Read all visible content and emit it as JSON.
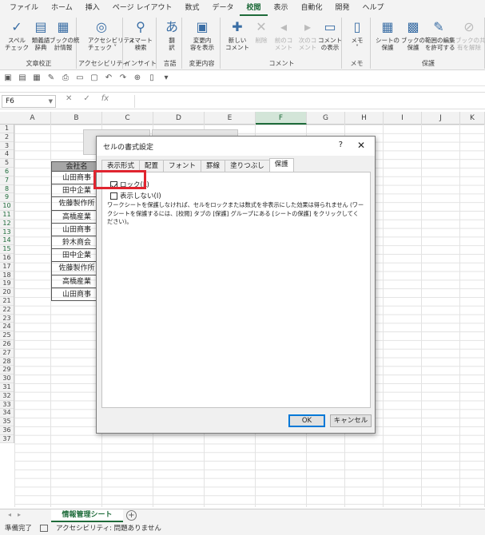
{
  "ribbon_tabs": [
    "ファイル",
    "ホーム",
    "挿入",
    "ページ レイアウト",
    "数式",
    "データ",
    "校閲",
    "表示",
    "自動化",
    "開発",
    "ヘルプ"
  ],
  "active_tab_index": 6,
  "ribbon": {
    "groups": [
      {
        "name": "文章校正",
        "buttons": [
          {
            "label": "スペル\nチェック",
            "icon": "spellcheck-icon"
          },
          {
            "label": "類義語\n辞典",
            "icon": "thesaurus-icon"
          },
          {
            "label": "ブックの統\n計情報",
            "icon": "workbook-stats-icon"
          }
        ]
      },
      {
        "name": "アクセシビリティ",
        "buttons": [
          {
            "label": "アクセシビリティ\nチェック ˅",
            "icon": "accessibility-icon"
          }
        ]
      },
      {
        "name": "インサイト",
        "buttons": [
          {
            "label": "スマート\n検索",
            "icon": "smart-lookup-icon"
          }
        ]
      },
      {
        "name": "言語",
        "buttons": [
          {
            "label": "翻\n訳",
            "icon": "translate-icon"
          }
        ]
      },
      {
        "name": "変更内容",
        "buttons": [
          {
            "label": "変更内\n容を表示",
            "icon": "show-changes-icon"
          }
        ]
      },
      {
        "name": "コメント",
        "buttons": [
          {
            "label": "新しい\nコメント",
            "icon": "new-comment-icon"
          },
          {
            "label": "削除",
            "icon": "delete-comment-icon",
            "disabled": true
          },
          {
            "label": "前のコ\nメント",
            "icon": "prev-comment-icon",
            "disabled": true
          },
          {
            "label": "次のコ\nメント",
            "icon": "next-comment-icon",
            "disabled": true
          },
          {
            "label": "コメント\nの表示",
            "icon": "show-comments-icon"
          }
        ]
      },
      {
        "name": "メモ",
        "buttons": [
          {
            "label": "メモ\n˅",
            "icon": "notes-icon"
          }
        ]
      },
      {
        "name": "保護",
        "buttons": [
          {
            "label": "シートの\n保護",
            "icon": "protect-sheet-icon"
          },
          {
            "label": "ブックの\n保護",
            "icon": "protect-workbook-icon"
          },
          {
            "label": "範囲の編集\nを許可する",
            "icon": "allow-edit-ranges-icon"
          },
          {
            "label": "ブックの共\n有を解除",
            "icon": "unshare-workbook-icon",
            "disabled": true
          }
        ]
      }
    ]
  },
  "formula_bar": {
    "name_box": "F6",
    "fx": "fx",
    "cancel": "✕",
    "enter": "✓",
    "value": ""
  },
  "columns": [
    "A",
    "B",
    "C",
    "D",
    "E",
    "F",
    "G",
    "H",
    "I",
    "J",
    "K"
  ],
  "selected_column": "F",
  "rows": [
    "1",
    "2",
    "3",
    "4",
    "5",
    "6",
    "7",
    "8",
    "9",
    "10",
    "11",
    "12",
    "13",
    "14",
    "15",
    "16",
    "17",
    "18",
    "19",
    "20",
    "21",
    "22",
    "23",
    "24",
    "25",
    "26",
    "27",
    "28",
    "29",
    "30",
    "31",
    "32",
    "33",
    "34",
    "35",
    "36",
    "37"
  ],
  "selected_rows": [
    "6",
    "7",
    "8",
    "9",
    "10",
    "11",
    "12",
    "13",
    "14",
    "15"
  ],
  "table": {
    "header": "会社名",
    "cells": [
      "山田商事",
      "田中企業",
      "佐藤製作所",
      "高橋産業",
      "山田商事",
      "鈴木商会",
      "田中企業",
      "佐藤製作所",
      "高橋産業",
      "山田商事"
    ]
  },
  "sheet_tab": "情報管理シート",
  "status": {
    "ready": "準備完了",
    "accessibility": "アクセシビリティ: 問題ありません"
  },
  "dialog": {
    "title": "セルの書式設定",
    "help": "?",
    "close": "✕",
    "tabs": [
      "表示形式",
      "配置",
      "フォント",
      "罫線",
      "塗りつぶし",
      "保護"
    ],
    "active_tab_index": 5,
    "lock_label": "ロック(L)",
    "hidden_label": "表示しない(I)",
    "lock_checked": true,
    "hidden_checked": false,
    "description": "ワークシートを保護しなければ、セルをロックまたは数式を非表示にした効果は得られません (ワークシートを保護するには、[校閲] タブの [保護] グループにある [シートの保護] をクリックしてください)。",
    "ok": "OK",
    "cancel": "キャンセル"
  },
  "colors": {
    "excel_green": "#1e6b3a",
    "highlight_red": "#e0242f",
    "table_header_gray": "#a6a6a6"
  }
}
